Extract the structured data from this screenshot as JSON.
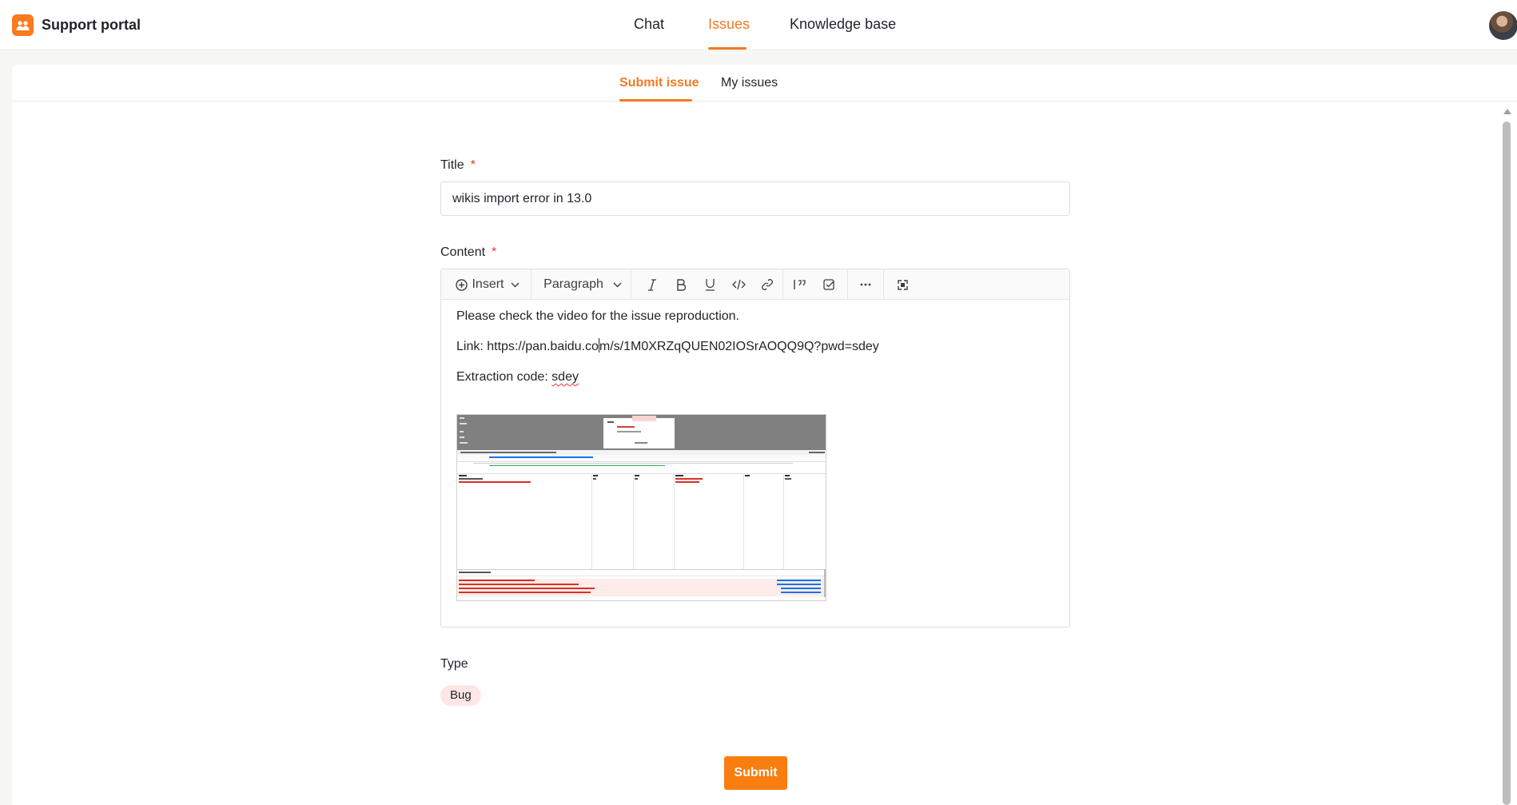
{
  "app": {
    "name": "Support portal",
    "brand_color": "#fa7a1e"
  },
  "nav": {
    "items": [
      {
        "label": "Chat"
      },
      {
        "label": "Issues",
        "active": true
      },
      {
        "label": "Knowledge base"
      }
    ],
    "accent": "#f47a22"
  },
  "subtabs": [
    {
      "label": "Submit issue",
      "active": true
    },
    {
      "label": "My issues"
    }
  ],
  "form": {
    "title": {
      "label": "Title",
      "required_mark": "*",
      "value": "wikis import error in 13.0"
    },
    "content": {
      "label": "Content",
      "required_mark": "*",
      "toolbar": {
        "insert_label": "Insert",
        "block_type": "Paragraph",
        "buttons": [
          "italic-icon",
          "bold-icon",
          "underline-icon",
          "code-icon",
          "link-icon",
          "quote-icon",
          "checklist-icon",
          "more-icon",
          "fullscreen-icon"
        ]
      },
      "paragraphs": {
        "line1": "Please check the video for the issue reproduction.",
        "line2_before_caret": "Link: https://pan.baidu.co",
        "line2_after_caret": "m/s/1M0XRZqQUEN02IOSrAOQQ9Q?pwd=sdey",
        "line3_prefix": "Extraction code: ",
        "line3_code": "sdey"
      },
      "embedded_image": "screenshot-thumbnail"
    },
    "type": {
      "label": "Type",
      "value": "Bug",
      "badge_color": "#fde7e4"
    },
    "submit_label": "Submit",
    "submit_color": "#fa7d10"
  }
}
